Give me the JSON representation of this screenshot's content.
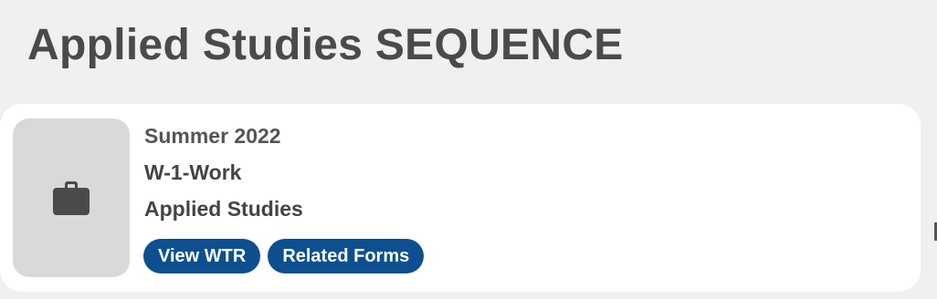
{
  "page": {
    "title": "Applied Studies SEQUENCE"
  },
  "card": {
    "icon": "briefcase-icon",
    "term": "Summer 2022",
    "code": "W-1-Work",
    "program": "Applied Studies",
    "buttons": {
      "view_wtr": "View WTR",
      "related_forms": "Related Forms"
    }
  },
  "colors": {
    "background": "#f0f0f0",
    "card": "#ffffff",
    "thumbnail": "#d9d9d9",
    "button": "#0e4f8f",
    "title_text": "#4a4a4a"
  }
}
